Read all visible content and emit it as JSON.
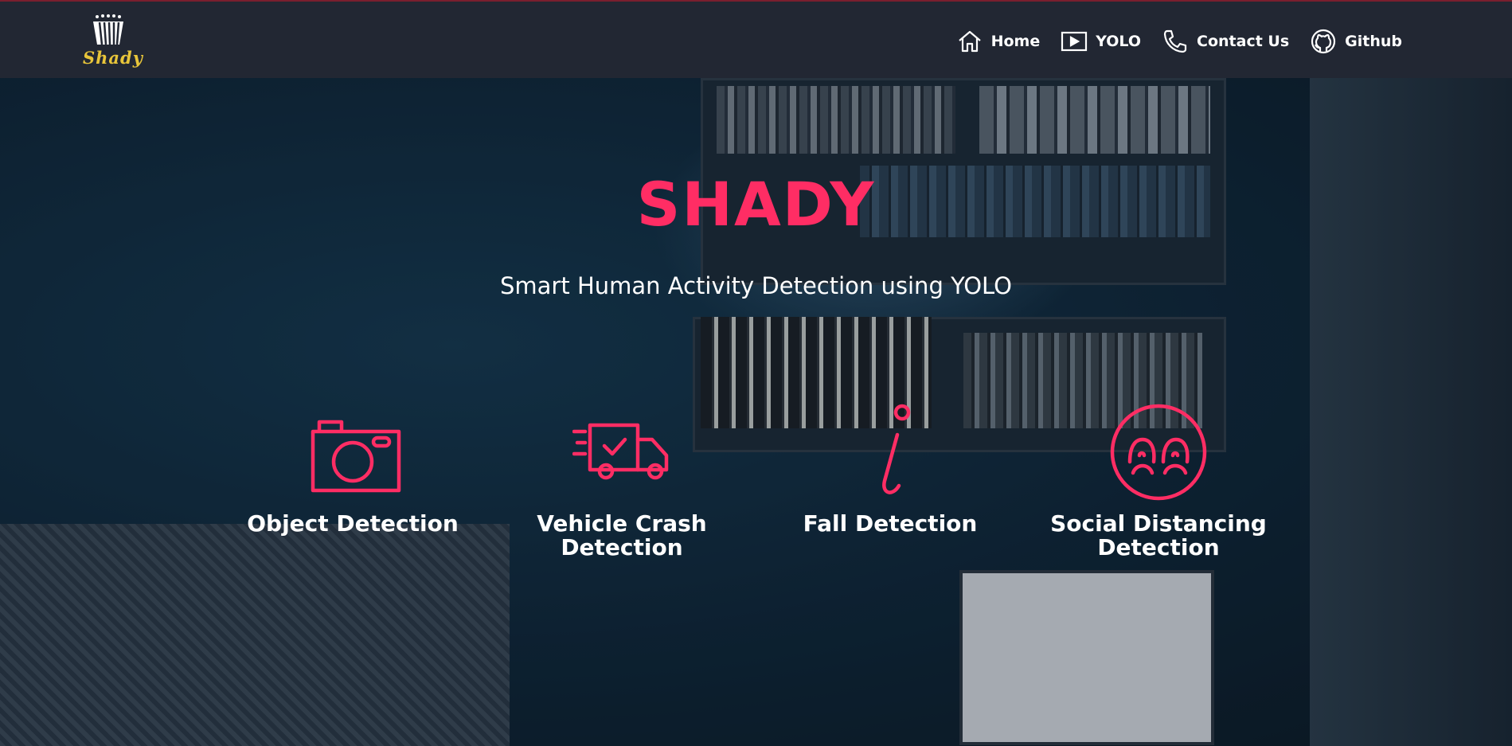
{
  "brand": {
    "logo_text": "Shady"
  },
  "nav": {
    "items": [
      {
        "label": "Home",
        "icon": "home-icon"
      },
      {
        "label": "YOLO",
        "icon": "play-icon"
      },
      {
        "label": "Contact Us",
        "icon": "phone-icon"
      },
      {
        "label": "Github",
        "icon": "github-icon"
      }
    ]
  },
  "hero": {
    "title": "SHADY",
    "subtitle": "Smart Human Activity Detection using YOLO"
  },
  "features": [
    {
      "label": "Object Detection",
      "icon": "camera-icon"
    },
    {
      "label": "Vehicle Crash Detection",
      "icon": "truck-icon"
    },
    {
      "label": "Fall Detection",
      "icon": "info-icon"
    },
    {
      "label": "Social Distancing Detection",
      "icon": "people-icon"
    }
  ],
  "colors": {
    "accent": "#ff2d64",
    "navbar": "#222733",
    "logo_yellow": "#e8c53a"
  }
}
